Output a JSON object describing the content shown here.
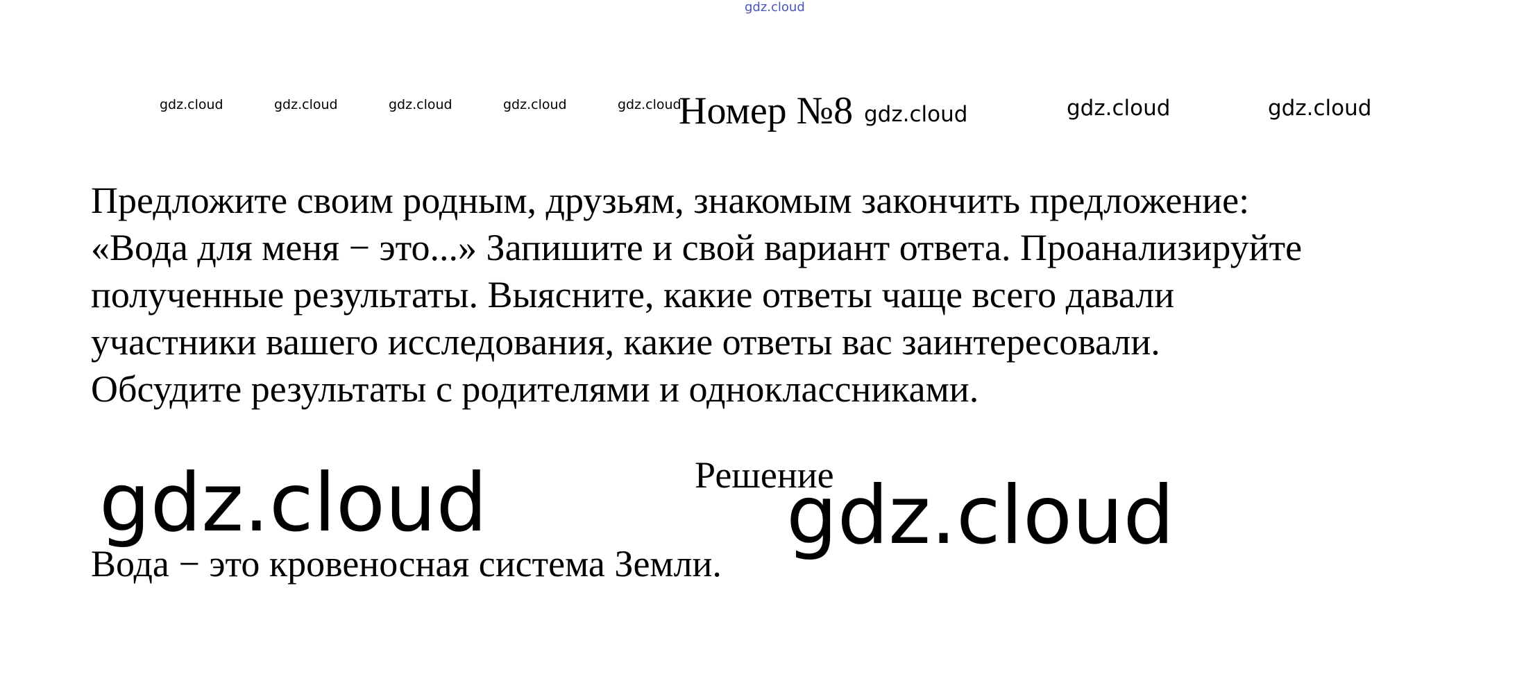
{
  "watermark": {
    "text": "gdz.cloud"
  },
  "problem": {
    "title": "Номер №8",
    "lines": [
      "Предложите своим родным, друзьям, знакомым закончить предложение:",
      "«Вода для меня − это...» Запишите и свой вариант ответа. Проанализируйте",
      "полученные результаты. Выясните, какие ответы чаще всего давали",
      "участники вашего исследования, какие ответы вас заинтересовали.",
      "Обсудите результаты с родителями и одноклассниками."
    ]
  },
  "solution": {
    "heading": "Решение",
    "answer": "Вода − это кровеносная система Земли."
  },
  "colors": {
    "text": "#000000",
    "top_watermark": "#4a55b8",
    "background": "#ffffff"
  }
}
